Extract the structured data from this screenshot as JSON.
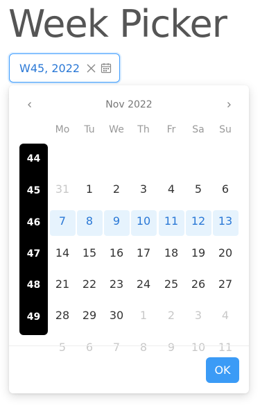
{
  "page": {
    "title": "Week Picker"
  },
  "input": {
    "value": "W45, 2022"
  },
  "calendar": {
    "month_label": "Nov 2022",
    "weekdays": [
      "Mo",
      "Tu",
      "We",
      "Th",
      "Fr",
      "Sa",
      "Su"
    ],
    "weeks": [
      {
        "num": "44",
        "days": [
          {
            "d": "31",
            "m": true
          },
          {
            "d": "1"
          },
          {
            "d": "2"
          },
          {
            "d": "3"
          },
          {
            "d": "4"
          },
          {
            "d": "5"
          },
          {
            "d": "6"
          }
        ]
      },
      {
        "num": "45",
        "selected": true,
        "days": [
          {
            "d": "7"
          },
          {
            "d": "8"
          },
          {
            "d": "9"
          },
          {
            "d": "10"
          },
          {
            "d": "11"
          },
          {
            "d": "12"
          },
          {
            "d": "13"
          }
        ]
      },
      {
        "num": "46",
        "days": [
          {
            "d": "14"
          },
          {
            "d": "15"
          },
          {
            "d": "16"
          },
          {
            "d": "17"
          },
          {
            "d": "18"
          },
          {
            "d": "19"
          },
          {
            "d": "20"
          }
        ]
      },
      {
        "num": "47",
        "days": [
          {
            "d": "21"
          },
          {
            "d": "22"
          },
          {
            "d": "23"
          },
          {
            "d": "24"
          },
          {
            "d": "25"
          },
          {
            "d": "26"
          },
          {
            "d": "27"
          }
        ]
      },
      {
        "num": "48",
        "days": [
          {
            "d": "28"
          },
          {
            "d": "29"
          },
          {
            "d": "30"
          },
          {
            "d": "1",
            "m": true
          },
          {
            "d": "2",
            "m": true
          },
          {
            "d": "3",
            "m": true
          },
          {
            "d": "4",
            "m": true
          }
        ]
      },
      {
        "num": "49",
        "days": [
          {
            "d": "5",
            "m": true
          },
          {
            "d": "6",
            "m": true
          },
          {
            "d": "7",
            "m": true
          },
          {
            "d": "8",
            "m": true
          },
          {
            "d": "9",
            "m": true
          },
          {
            "d": "10",
            "m": true
          },
          {
            "d": "11",
            "m": true
          }
        ]
      }
    ]
  },
  "footer": {
    "ok_label": "OK"
  },
  "icons": {
    "clear": "close-icon",
    "calendar": "calendar-icon",
    "prev": "chevron-left-icon",
    "next": "chevron-right-icon"
  },
  "colors": {
    "accent": "#409eff",
    "selected_bg": "#e6f3fd",
    "week_column_bg": "#000000",
    "ok_button": "#3b9bf6"
  }
}
